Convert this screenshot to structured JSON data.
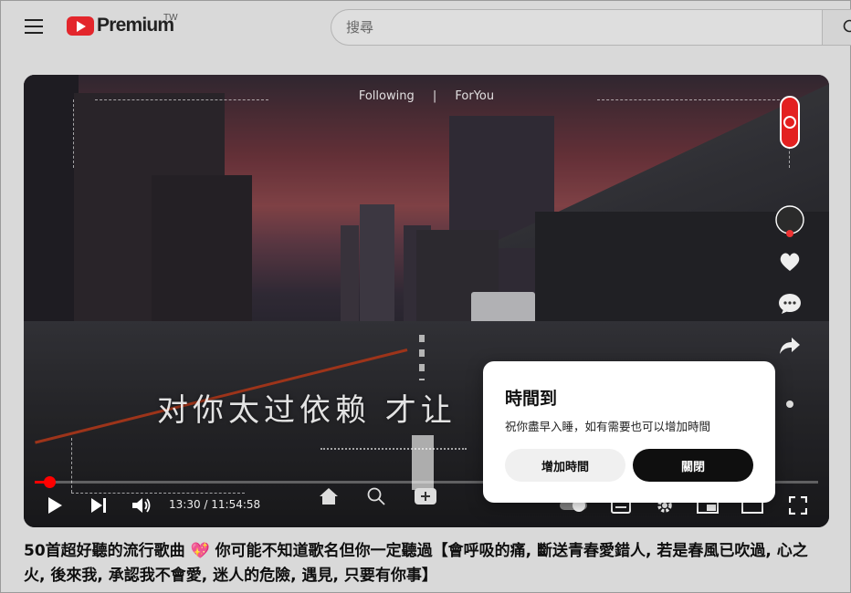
{
  "header": {
    "logo_text": "Premium",
    "region": "TW",
    "search_placeholder": "搜尋"
  },
  "player": {
    "feed_tabs": [
      "Following",
      "|",
      "ForYou"
    ],
    "lyric": "对你太过依赖 才让",
    "time_display": "13:30 / 11:54:58",
    "progress": 0.019,
    "accent_color": "#ff0000"
  },
  "dialog": {
    "title": "時間到",
    "message": "祝你盡早入睡，如有需要也可以增加時間",
    "add_time_label": "增加時間",
    "close_label": "關閉"
  },
  "video": {
    "title": "50首超好聽的流行歌曲 💖 你可能不知道歌名但你一定聽過【會呼吸的痛, 斷送青春愛錯人, 若是春風已吹過, 心之火, 後來我, 承認我不會愛, 迷人的危險, 遇見, 只要有你事】"
  },
  "icons": {
    "menu": "menu-icon",
    "search": "search-icon",
    "play": "play-icon",
    "next": "next-icon",
    "volume": "volume-icon",
    "fullscreen": "fullscreen-icon"
  }
}
